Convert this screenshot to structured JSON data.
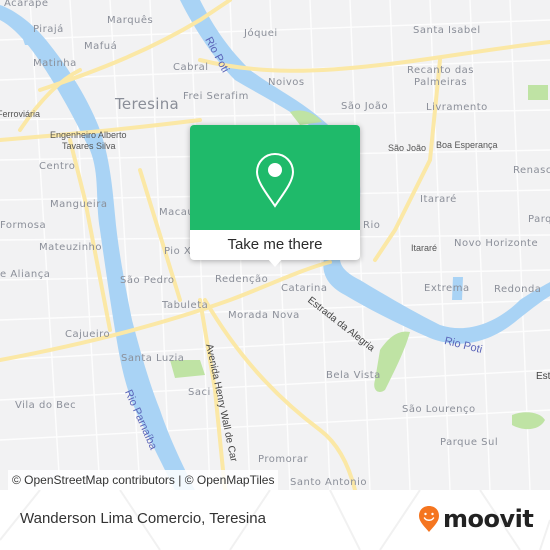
{
  "map": {
    "city_label": "Teresina",
    "neighborhoods": [
      {
        "id": "acarape",
        "name": "Acarape"
      },
      {
        "id": "marques",
        "name": "Marquês"
      },
      {
        "id": "joquei",
        "name": "Jóquei"
      },
      {
        "id": "santa-isabel",
        "name": "Santa Isabel"
      },
      {
        "id": "piraja",
        "name": "Pirajá"
      },
      {
        "id": "mafua",
        "name": "Mafuá"
      },
      {
        "id": "matinha",
        "name": "Matinha"
      },
      {
        "id": "cabral",
        "name": "Cabral"
      },
      {
        "id": "noivos",
        "name": "Noivos"
      },
      {
        "id": "recanto-das-palmeiras-1",
        "name": "Recanto das"
      },
      {
        "id": "recanto-das-palmeiras-2",
        "name": "Palmeiras"
      },
      {
        "id": "frei-serafim",
        "name": "Frei Serafim"
      },
      {
        "id": "sao-joao",
        "name": "São João"
      },
      {
        "id": "livramento",
        "name": "Livramento"
      },
      {
        "id": "centro",
        "name": "Centro"
      },
      {
        "id": "renascenca",
        "name": "Renasc"
      },
      {
        "id": "itarare",
        "name": "Itararé"
      },
      {
        "id": "mangueira",
        "name": "Mangueira"
      },
      {
        "id": "formosa",
        "name": "Formosa"
      },
      {
        "id": "macauba",
        "name": "Macaú"
      },
      {
        "id": "parque",
        "name": "Parq"
      },
      {
        "id": "mateuzinho",
        "name": "Mateuzinho"
      },
      {
        "id": "pio-xii",
        "name": "Pio X"
      },
      {
        "id": "rio",
        "name": "Rio"
      },
      {
        "id": "novo-horizonte",
        "name": "Novo Horizonte"
      },
      {
        "id": "alianca",
        "name": "e Aliança"
      },
      {
        "id": "sao-pedro",
        "name": "São Pedro"
      },
      {
        "id": "redencao",
        "name": "Redenção"
      },
      {
        "id": "catarina",
        "name": "Catarina"
      },
      {
        "id": "extrema",
        "name": "Extrema"
      },
      {
        "id": "redonda",
        "name": "Redonda"
      },
      {
        "id": "tabuleta",
        "name": "Tabuleta"
      },
      {
        "id": "morada-nova",
        "name": "Morada Nova"
      },
      {
        "id": "cajueiro",
        "name": "Cajueiro"
      },
      {
        "id": "santa-luzia",
        "name": "Santa Luzia"
      },
      {
        "id": "bela-vista",
        "name": "Bela Vista"
      },
      {
        "id": "saci",
        "name": "Saci"
      },
      {
        "id": "vila-do-bec",
        "name": "Vila do Bec"
      },
      {
        "id": "sao-lourenco",
        "name": "São Lourenço"
      },
      {
        "id": "parque-sul",
        "name": "Parque Sul"
      },
      {
        "id": "promorar",
        "name": "Promorar"
      },
      {
        "id": "santo-antonio",
        "name": "Santo Antonio"
      }
    ],
    "pois": [
      {
        "id": "ferroviaria",
        "name": "Ferroviária"
      },
      {
        "id": "engenheiro-1",
        "name": "Engenheiro Alberto"
      },
      {
        "id": "engenheiro-2",
        "name": "Tavares Silva"
      },
      {
        "id": "sao-joao-station",
        "name": "São João"
      },
      {
        "id": "boa-esperanca",
        "name": "Boa Esperança"
      },
      {
        "id": "itarare-station",
        "name": "Itararé"
      }
    ],
    "roads": [
      {
        "id": "estrada-da-alegria",
        "name": "Estrada da Alegria"
      },
      {
        "id": "avenida-henry-wall",
        "name": "Avenida Henry Wall de Car"
      },
      {
        "id": "est-east",
        "name": "Est"
      }
    ],
    "rivers": [
      {
        "id": "rio-poti-north",
        "name": "Rio Poti"
      },
      {
        "id": "rio-poti-south",
        "name": "Rio Poti"
      },
      {
        "id": "rio-parnaiba",
        "name": "Rio Parnaíba"
      }
    ],
    "colors": {
      "land": "#f2f2f3",
      "water": "#a9d3f5",
      "road_major": "#fbe8a6",
      "park": "#bfe3a4",
      "label": "#8b8f99",
      "river_label": "#5a64b8"
    }
  },
  "popup": {
    "icon": "location-pin-icon",
    "button_label": "Take me there",
    "accent": "#1fba6a"
  },
  "attribution": "© OpenStreetMap contributors | © OpenMapTiles",
  "footer": {
    "title": "Wanderson Lima Comercio, Teresina",
    "brand": "moovit",
    "brand_color": "#f5751f"
  }
}
